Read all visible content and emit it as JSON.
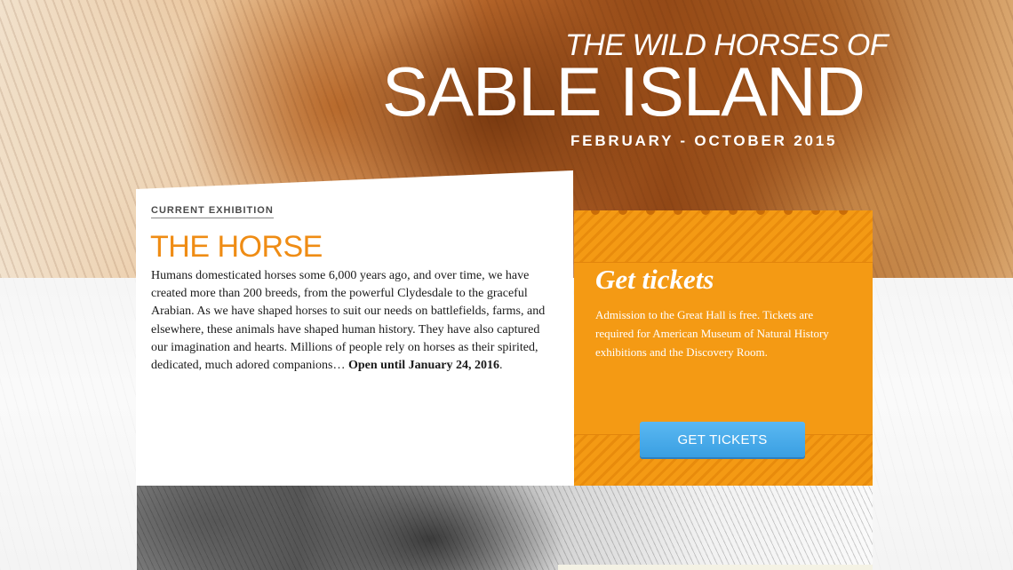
{
  "hero": {
    "title_small": "THE WILD HORSES OF",
    "title_large": "SABLE ISLAND",
    "dates": "FEBRUARY - OCTOBER 2015",
    "image": "horse-photo"
  },
  "exhibition": {
    "eyebrow": "CURRENT EXHIBITION",
    "title": "THE HORSE",
    "body": "Humans domesticated horses some 6,000 years ago, and over time, we have created more than 200 breeds, from the powerful Clydesdale to the graceful Arabian. As we have shaped horses to suit our needs on battlefields, farms, and elsewhere, these animals have shaped human history. They have also captured our imagination and hearts. Millions of people rely on horses as their spirited, dedicated, much adored companions…",
    "open_until": "Open until January 24, 2016",
    "period": "."
  },
  "tickets": {
    "heading": "Get tickets",
    "text": "Admission to the Great Hall is free. Tickets are required for American Museum of Natural History exhibitions and the Discovery Room.",
    "button_label": "GET TICKETS"
  },
  "colors": {
    "accent_orange": "#f49a14",
    "title_orange": "#ef8c14",
    "button_blue": "#3a9fe2"
  }
}
